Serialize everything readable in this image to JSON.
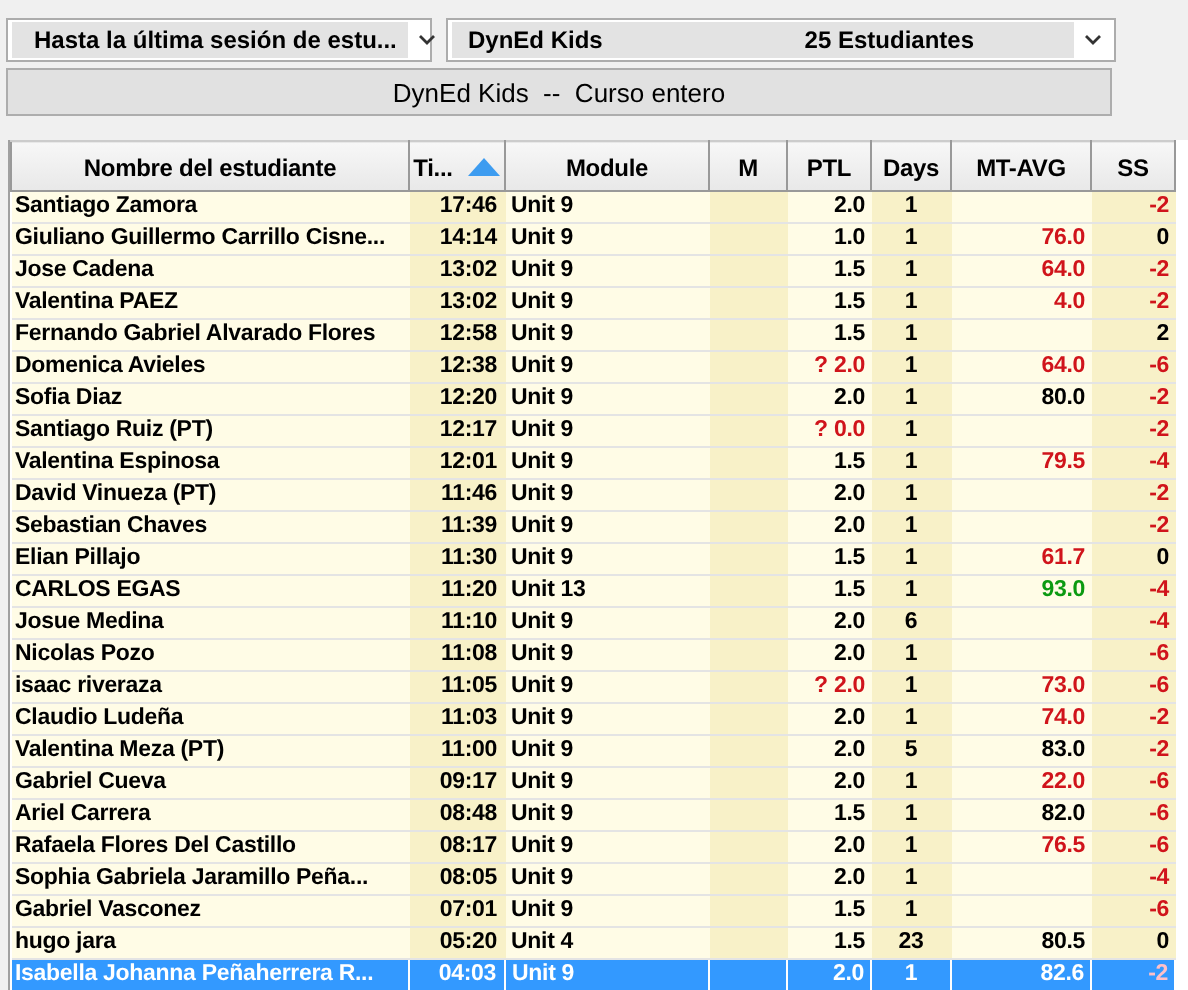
{
  "filters": {
    "period": "Hasta la última sesión de estu...",
    "course": "DynEd Kids",
    "count": "25 Estudiantes"
  },
  "scope_button": "DynEd Kids  --  Curso entero",
  "table": {
    "columns": [
      {
        "label": "Nombre del estudiante",
        "sorted": false
      },
      {
        "label": "Ti...",
        "sorted": true
      },
      {
        "label": "Module",
        "sorted": false
      },
      {
        "label": "M",
        "sorted": false
      },
      {
        "label": "PTL",
        "sorted": false
      },
      {
        "label": "Days",
        "sorted": false
      },
      {
        "label": "MT-AVG",
        "sorted": false
      },
      {
        "label": "SS",
        "sorted": false
      }
    ],
    "rows": [
      {
        "name": "Santiago Zamora",
        "time": "17:46",
        "module": "Unit 9",
        "ptl": "2.0",
        "ptl_warning": false,
        "days": "1",
        "ss": "-2",
        "ss_warning": true,
        "selected": false
      },
      {
        "name": "Giuliano Guillermo Carrillo Cisne...",
        "time": "14:14",
        "module": "Unit 9",
        "ptl": "1.0",
        "ptl_warning": false,
        "days": "1",
        "mt_avg": "76.0",
        "mt_low": true,
        "mt_high": false,
        "ss": "0",
        "ss_warning": false,
        "selected": false
      },
      {
        "name": "Jose Cadena",
        "time": "13:02",
        "module": "Unit 9",
        "ptl": "1.5",
        "ptl_warning": false,
        "days": "1",
        "mt_avg": "64.0",
        "mt_low": true,
        "mt_high": false,
        "ss": "-2",
        "ss_warning": true,
        "selected": false
      },
      {
        "name": "Valentina PAEZ",
        "time": "13:02",
        "module": "Unit 9",
        "ptl": "1.5",
        "ptl_warning": false,
        "days": "1",
        "mt_avg": "4.0",
        "mt_low": true,
        "mt_high": false,
        "ss": "-2",
        "ss_warning": true,
        "selected": false
      },
      {
        "name": "Fernando Gabriel Alvarado Flores",
        "time": "12:58",
        "module": "Unit 9",
        "ptl": "1.5",
        "ptl_warning": false,
        "days": "1",
        "ss": "2",
        "ss_warning": false,
        "selected": false
      },
      {
        "name": "Domenica Avieles",
        "time": "12:38",
        "module": "Unit 9",
        "ptl": "? 2.0",
        "ptl_warning": true,
        "days": "1",
        "mt_avg": "64.0",
        "mt_low": true,
        "mt_high": false,
        "ss": "-6",
        "ss_warning": true,
        "selected": false
      },
      {
        "name": "Sofia Diaz",
        "time": "12:20",
        "module": "Unit 9",
        "ptl": "2.0",
        "ptl_warning": false,
        "days": "1",
        "mt_avg": "80.0",
        "mt_low": false,
        "mt_high": false,
        "ss": "-2",
        "ss_warning": true,
        "selected": false
      },
      {
        "name": "Santiago Ruiz (PT)",
        "time": "12:17",
        "module": "Unit 9",
        "ptl": "? 0.0",
        "ptl_warning": true,
        "days": "1",
        "ss": "-2",
        "ss_warning": true,
        "selected": false
      },
      {
        "name": "Valentina Espinosa",
        "time": "12:01",
        "module": "Unit 9",
        "ptl": "1.5",
        "ptl_warning": false,
        "days": "1",
        "mt_avg": "79.5",
        "mt_low": true,
        "mt_high": false,
        "ss": "-4",
        "ss_warning": true,
        "selected": false
      },
      {
        "name": "David Vinueza (PT)",
        "time": "11:46",
        "module": "Unit 9",
        "ptl": "2.0",
        "ptl_warning": false,
        "days": "1",
        "ss": "-2",
        "ss_warning": true,
        "selected": false
      },
      {
        "name": "Sebastian Chaves",
        "time": "11:39",
        "module": "Unit 9",
        "ptl": "2.0",
        "ptl_warning": false,
        "days": "1",
        "ss": "-2",
        "ss_warning": true,
        "selected": false
      },
      {
        "name": "Elian Pillajo",
        "time": "11:30",
        "module": "Unit 9",
        "ptl": "1.5",
        "ptl_warning": false,
        "days": "1",
        "mt_avg": "61.7",
        "mt_low": true,
        "mt_high": false,
        "ss": "0",
        "ss_warning": false,
        "selected": false
      },
      {
        "name": "CARLOS EGAS",
        "time": "11:20",
        "module": "Unit 13",
        "ptl": "1.5",
        "ptl_warning": false,
        "days": "1",
        "mt_avg": "93.0",
        "mt_low": false,
        "mt_high": true,
        "ss": "-4",
        "ss_warning": true,
        "selected": false
      },
      {
        "name": "Josue Medina",
        "time": "11:10",
        "module": "Unit 9",
        "ptl": "2.0",
        "ptl_warning": false,
        "days": "6",
        "ss": "-4",
        "ss_warning": true,
        "selected": false
      },
      {
        "name": "Nicolas Pozo",
        "time": "11:08",
        "module": "Unit 9",
        "ptl": "2.0",
        "ptl_warning": false,
        "days": "1",
        "ss": "-6",
        "ss_warning": true,
        "selected": false
      },
      {
        "name": "isaac riveraza",
        "time": "11:05",
        "module": "Unit 9",
        "ptl": "? 2.0",
        "ptl_warning": true,
        "days": "1",
        "mt_avg": "73.0",
        "mt_low": true,
        "mt_high": false,
        "ss": "-6",
        "ss_warning": true,
        "selected": false
      },
      {
        "name": "Claudio Ludeña",
        "time": "11:03",
        "module": "Unit 9",
        "ptl": "2.0",
        "ptl_warning": false,
        "days": "1",
        "mt_avg": "74.0",
        "mt_low": true,
        "mt_high": false,
        "ss": "-2",
        "ss_warning": true,
        "selected": false
      },
      {
        "name": "Valentina Meza (PT)",
        "time": "11:00",
        "module": "Unit 9",
        "ptl": "2.0",
        "ptl_warning": false,
        "days": "5",
        "mt_avg": "83.0",
        "mt_low": false,
        "mt_high": false,
        "ss": "-2",
        "ss_warning": true,
        "selected": false
      },
      {
        "name": "Gabriel Cueva",
        "time": "09:17",
        "module": "Unit 9",
        "ptl": "2.0",
        "ptl_warning": false,
        "days": "1",
        "mt_avg": "22.0",
        "mt_low": true,
        "mt_high": false,
        "ss": "-6",
        "ss_warning": true,
        "selected": false
      },
      {
        "name": "Ariel Carrera",
        "time": "08:48",
        "module": "Unit 9",
        "ptl": "1.5",
        "ptl_warning": false,
        "days": "1",
        "mt_avg": "82.0",
        "mt_low": false,
        "mt_high": false,
        "ss": "-6",
        "ss_warning": true,
        "selected": false
      },
      {
        "name": "Rafaela Flores Del Castillo",
        "time": "08:17",
        "module": "Unit 9",
        "ptl": "2.0",
        "ptl_warning": false,
        "days": "1",
        "mt_avg": "76.5",
        "mt_low": true,
        "mt_high": false,
        "ss": "-6",
        "ss_warning": true,
        "selected": false
      },
      {
        "name": "Sophia Gabriela Jaramillo Peña...",
        "time": "08:05",
        "module": "Unit 9",
        "ptl": "2.0",
        "ptl_warning": false,
        "days": "1",
        "ss": "-4",
        "ss_warning": true,
        "selected": false
      },
      {
        "name": "Gabriel Vasconez",
        "time": "07:01",
        "module": "Unit 9",
        "ptl": "1.5",
        "ptl_warning": false,
        "days": "1",
        "ss": "-6",
        "ss_warning": true,
        "selected": false
      },
      {
        "name": "hugo jara",
        "time": "05:20",
        "module": "Unit 4",
        "ptl": "1.5",
        "ptl_warning": false,
        "days": "23",
        "mt_avg": "80.5",
        "mt_low": false,
        "mt_high": false,
        "ss": "0",
        "ss_warning": false,
        "selected": false
      },
      {
        "name": "Isabella Johanna Peñaherrera R...",
        "time": "04:03",
        "module": "Unit 9",
        "ptl": "2.0",
        "ptl_warning": false,
        "days": "1",
        "mt_avg": "82.6",
        "mt_low": false,
        "mt_high": false,
        "ss": "-2",
        "ss_warning": true,
        "selected": true
      }
    ]
  }
}
